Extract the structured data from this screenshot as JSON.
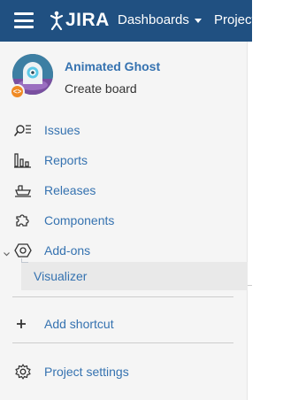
{
  "header": {
    "logo_text": "JIRA",
    "dashboards_label": "Dashboards",
    "projects_label": "Project"
  },
  "project": {
    "name": "Animated Ghost",
    "subtitle": "Create board"
  },
  "sidebar": {
    "items": [
      {
        "label": "Issues",
        "icon": "search-list-icon"
      },
      {
        "label": "Reports",
        "icon": "bar-chart-icon"
      },
      {
        "label": "Releases",
        "icon": "ship-icon"
      },
      {
        "label": "Components",
        "icon": "puzzle-icon"
      },
      {
        "label": "Add-ons",
        "icon": "hexagon-icon"
      }
    ],
    "sub_items": [
      {
        "label": "Visualizer"
      }
    ],
    "add_shortcut_label": "Add shortcut",
    "settings_label": "Project settings"
  },
  "colors": {
    "header_bg": "#205081",
    "link": "#3572b0",
    "sidebar_bg": "#f5f5f5",
    "selected_bg": "#e9e9e9",
    "badge": "#f08a24"
  }
}
